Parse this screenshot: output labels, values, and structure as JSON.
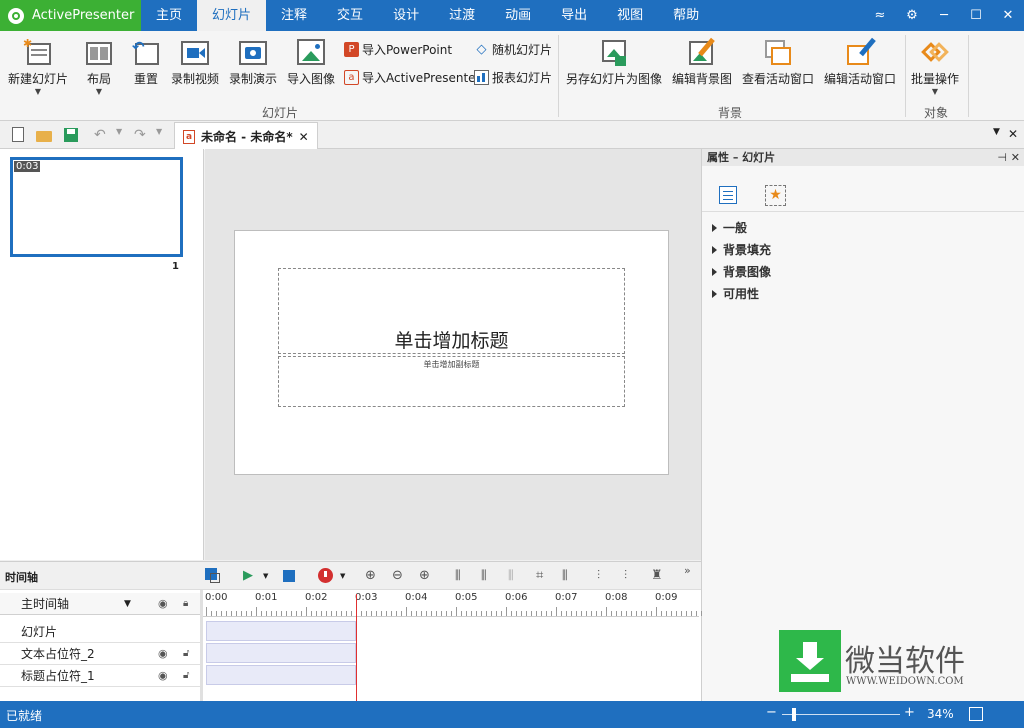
{
  "app": {
    "name": "ActivePresenter"
  },
  "tabs": [
    {
      "label": "主页"
    },
    {
      "label": "幻灯片"
    },
    {
      "label": "注释"
    },
    {
      "label": "交互"
    },
    {
      "label": "设计"
    },
    {
      "label": "过渡"
    },
    {
      "label": "动画"
    },
    {
      "label": "导出"
    },
    {
      "label": "视图"
    },
    {
      "label": "帮助"
    }
  ],
  "active_tab_index": 1,
  "window_controls": {
    "collapse": "≈",
    "settings": "⚙",
    "minimize": "─",
    "maximize": "☐",
    "close": "✕"
  },
  "ribbon": {
    "slides": {
      "new_slide": "新建幻灯片",
      "layout": "布局",
      "reset": "重置",
      "record_video": "录制视频",
      "record_demo": "录制演示",
      "import_image": "导入图像",
      "import_ppt": "导入PowerPoint",
      "import_ap": "导入ActivePresenter",
      "random_slide": "随机幻灯片",
      "report_slide": "报表幻灯片",
      "group_label": "幻灯片"
    },
    "background": {
      "save_as_image": "另存幻灯片为图像",
      "edit_background": "编辑背景图",
      "view_active_window": "查看活动窗口",
      "edit_active_window": "编辑活动窗口",
      "group_label": "背景"
    },
    "objects": {
      "batch_ops": "批量操作",
      "group_label": "对象"
    }
  },
  "document_tab": {
    "title": "未命名 - 未命名*",
    "close": "✕"
  },
  "slide_panel": {
    "thumb_time": "0:03",
    "thumb_number": "1"
  },
  "slide": {
    "title_placeholder": "单击增加标题",
    "subtitle_placeholder": "单击增加副标题"
  },
  "properties": {
    "header": "属性 – 幻灯片",
    "sections": [
      "一般",
      "背景填充",
      "背景图像",
      "可用性"
    ]
  },
  "timeline": {
    "title": "时间轴",
    "main_timeline": "主时间轴",
    "rows": [
      "幻灯片",
      "文本占位符_2",
      "标题占位符_1"
    ],
    "ticks": [
      "0:00",
      "0:01",
      "0:02",
      "0:03",
      "0:04",
      "0:05",
      "0:06",
      "0:07",
      "0:08",
      "0:09"
    ],
    "more": "»"
  },
  "status": {
    "text": "已就绪",
    "zoom": "34%"
  },
  "watermark": {
    "cn": "微当软件",
    "en": "WWW.WEIDOWN.COM"
  },
  "colors": {
    "titlebar": "#1f6fbf",
    "appbtn": "#3cb034",
    "accent": "#1f6fbf",
    "playhead": "#e03030"
  }
}
